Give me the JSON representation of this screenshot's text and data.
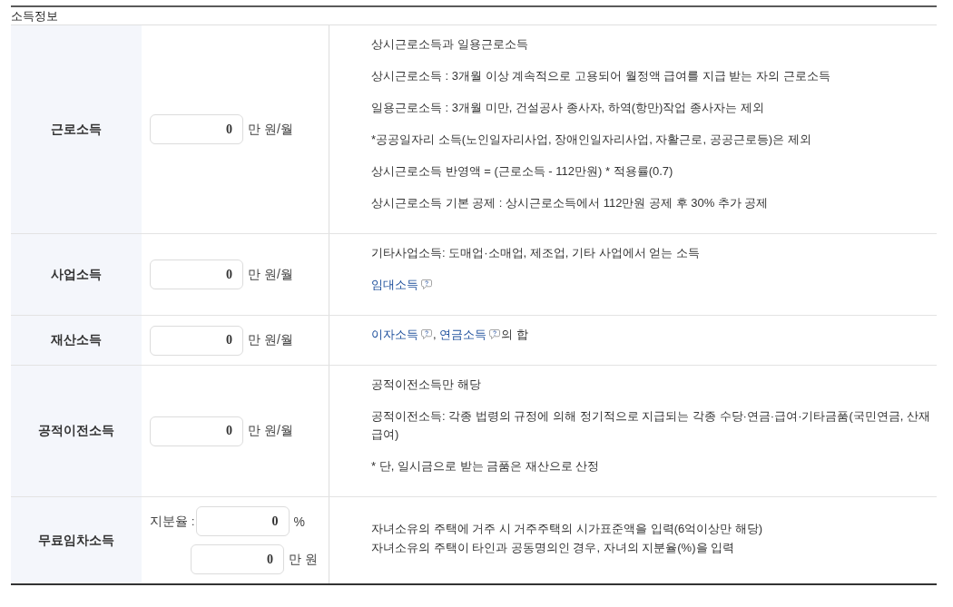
{
  "section": {
    "title": "소득정보"
  },
  "rows": [
    {
      "kind": "monthly",
      "label": "근로소득",
      "inputs": [
        {
          "value": "0",
          "unit": "만 원/월"
        }
      ],
      "notes": [
        {
          "parts": [
            {
              "kind": "text",
              "text": "상시근로소득과 일용근로소득"
            }
          ]
        },
        {
          "parts": [
            {
              "kind": "text",
              "text": "상시근로소득 : 3개월 이상 계속적으로 고용되어 월정액 급여를 지급 받는 자의 근로소득"
            }
          ]
        },
        {
          "parts": [
            {
              "kind": "text",
              "text": "일용근로소득 : 3개월 미만, 건설공사 종사자, 하역(항만)작업 종사자는 제외"
            }
          ]
        },
        {
          "parts": [
            {
              "kind": "text",
              "text": "*공공일자리 소득(노인일자리사업, 장애인일자리사업, 자활근로, 공공근로등)은 제외"
            }
          ]
        },
        {
          "parts": [
            {
              "kind": "text",
              "text": "상시근로소득 반영액 = (근로소득 - 112만원) * 적용률(0.7)"
            }
          ]
        },
        {
          "parts": [
            {
              "kind": "text",
              "text": "상시근로소득 기본 공제 : 상시근로소득에서 112만원 공제 후 30% 추가 공제"
            }
          ]
        }
      ]
    },
    {
      "kind": "monthly",
      "label": "사업소득",
      "inputs": [
        {
          "value": "0",
          "unit": "만 원/월"
        }
      ],
      "notes": [
        {
          "parts": [
            {
              "kind": "text",
              "text": "기타사업소득: 도매업·소매업, 제조업, 기타 사업에서 얻는 소득"
            }
          ]
        },
        {
          "parts": [
            {
              "kind": "help_link",
              "text": "임대소득"
            }
          ]
        }
      ]
    },
    {
      "kind": "monthly",
      "label": "재산소득",
      "inputs": [
        {
          "value": "0",
          "unit": "만 원/월"
        }
      ],
      "notes": [
        {
          "parts": [
            {
              "kind": "help_link",
              "text": "이자소득",
              "suffix": ", "
            },
            {
              "kind": "help_link",
              "text": "연금소득",
              "suffix": "의 합"
            }
          ]
        }
      ]
    },
    {
      "kind": "monthly",
      "label": "공적이전소득",
      "inputs": [
        {
          "value": "0",
          "unit": "만 원/월"
        }
      ],
      "notes": [
        {
          "parts": [
            {
              "kind": "text",
              "text": "공적이전소득만 해당"
            }
          ]
        },
        {
          "parts": [
            {
              "kind": "text",
              "text": "공적이전소득: 각종 법령의 규정에 의해 정기적으로 지급되는 각종 수당·연금·급여·기타금품(국민연금, 산재 급여)"
            }
          ]
        },
        {
          "parts": [
            {
              "kind": "text",
              "text": "* 단, 일시금으로 받는 금품은 재산으로 산정"
            }
          ]
        }
      ]
    },
    {
      "kind": "rent_free",
      "label": "무료임차소득",
      "inputs": [
        {
          "caption": "지분율 :",
          "value": "0",
          "unit": "%"
        },
        {
          "value": "0",
          "unit": "만 원"
        }
      ],
      "notes": [
        {
          "parts": [
            {
              "kind": "text",
              "text": "자녀소유의 주택에 거주 시 거주주택의 시가표준액을 입력(6억이상만 해당)"
            }
          ]
        },
        {
          "parts": [
            {
              "kind": "text",
              "text": "자녀소유의 주택이 타인과 공동명의인 경우, 자녀의 지분율(%)을 입력"
            }
          ]
        }
      ]
    }
  ]
}
